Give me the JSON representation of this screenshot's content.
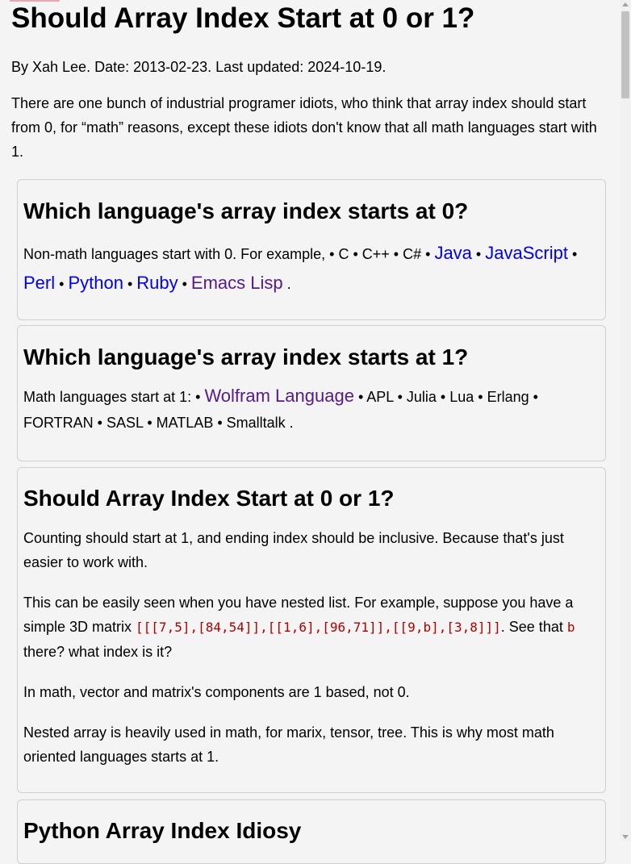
{
  "page": {
    "title": "Should Array Index Start at 0 or 1?",
    "byline": "By Xah Lee. Date: 2013-02-23. Last updated: 2024-10-19.",
    "intro": "There are one bunch of industrial programer idiots, who think that array index should start from 0, for “math” reasons, except these idiots don't know that all math languages start with 1."
  },
  "sections": {
    "zero": {
      "heading": "Which language's array index starts at 0?",
      "prefix": "Non-math languages start with 0. For example, • C • C++ • C# • ",
      "links": [
        "Java",
        "JavaScript",
        "Perl",
        "Python",
        "Ruby",
        "Emacs Lisp"
      ],
      "sep": " • ",
      "end": " ."
    },
    "one": {
      "heading": "Which language's array index starts at 1?",
      "prefix": "Math languages start at 1: • ",
      "link": "Wolfram Language",
      "rest": " • APL • Julia • Lua • Erlang • FORTRAN • SASL • MATLAB • Smalltalk ."
    },
    "should": {
      "heading": "Should Array Index Start at 0 or 1?",
      "p1": "Counting should start at 1, and ending index should be inclusive. Because that's just easier to work with.",
      "p2_a": "This can be easily seen when you have nested list. For example, suppose you have a simple 3D matrix ",
      "p2_code": "[[[7,5],[84,54]],[[1,6],[96,71]],[[9,b],[3,8]]]",
      "p2_b": ". See that ",
      "p2_code2": "b",
      "p2_c": " there? what index is it?",
      "p3": "In math, vector and matrix's components are 1 based, not 0.",
      "p4": "Nested array is heavily used in math, for marix, tensor, tree. This is why most math oriented languages starts at 1."
    },
    "python": {
      "heading": "Python Array Index Idiosy"
    }
  }
}
